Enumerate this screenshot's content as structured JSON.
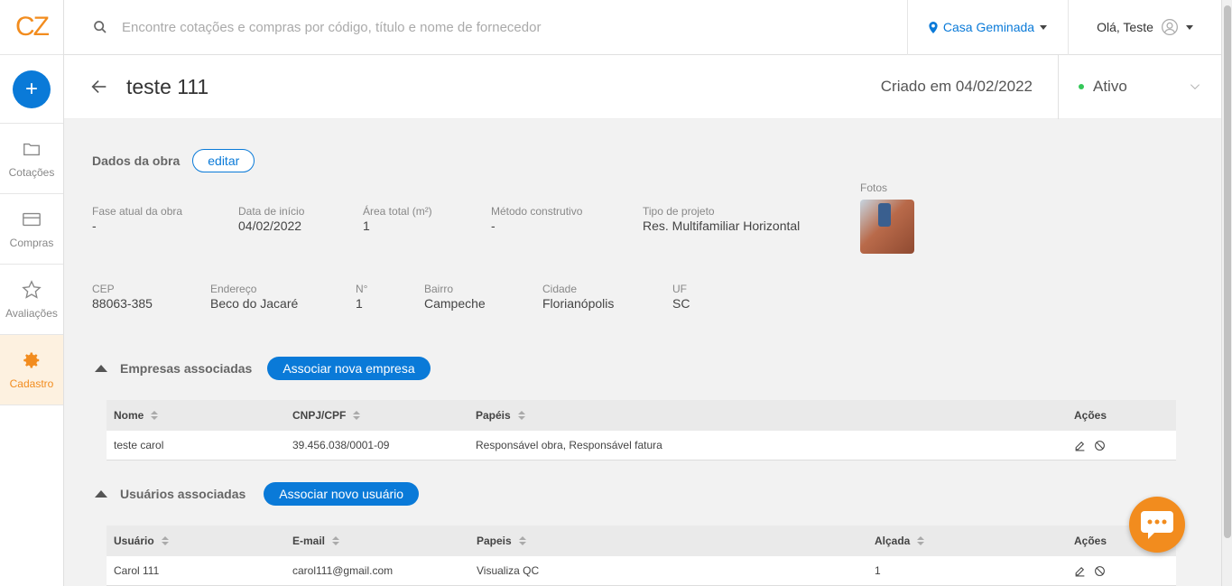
{
  "brand": {
    "logo_text": "CZ",
    "accent": "#f28c1e",
    "primary": "#0a7ad8"
  },
  "sidebar": {
    "new_label": "+",
    "items": [
      {
        "label": "Cotações",
        "icon": "folder-icon"
      },
      {
        "label": "Compras",
        "icon": "card-icon"
      },
      {
        "label": "Avaliações",
        "icon": "star-icon"
      },
      {
        "label": "Cadastro",
        "icon": "gear-icon",
        "active": true
      }
    ]
  },
  "topbar": {
    "search_placeholder": "Encontre cotações e compras por código, título e nome de fornecedor",
    "location": "Casa Geminada",
    "greeting": "Olá, Teste"
  },
  "header": {
    "title": "teste 111",
    "created": "Criado em 04/02/2022",
    "status": "Ativo"
  },
  "obra": {
    "section_title": "Dados da obra",
    "edit_label": "editar",
    "fotos_label": "Fotos",
    "row1": [
      {
        "label": "Fase atual da obra",
        "value": "-"
      },
      {
        "label": "Data de início",
        "value": "04/02/2022"
      },
      {
        "label": "Área total (m²)",
        "value": "1"
      },
      {
        "label": "Método construtivo",
        "value": "-"
      },
      {
        "label": "Tipo de projeto",
        "value": "Res. Multifamiliar Horizontal"
      }
    ],
    "row2": [
      {
        "label": "CEP",
        "value": "88063-385"
      },
      {
        "label": "Endereço",
        "value": "Beco do Jacaré"
      },
      {
        "label": "N°",
        "value": "1"
      },
      {
        "label": "Bairro",
        "value": "Campeche"
      },
      {
        "label": "Cidade",
        "value": "Florianópolis"
      },
      {
        "label": "UF",
        "value": "SC"
      }
    ]
  },
  "empresas": {
    "title": "Empresas associadas",
    "button": "Associar nova empresa",
    "columns": [
      "Nome",
      "CNPJ/CPF",
      "Papéis",
      "Ações"
    ],
    "rows": [
      {
        "nome": "teste carol",
        "cnpj": "39.456.038/0001-09",
        "papeis": "Responsável obra, Responsável fatura"
      }
    ]
  },
  "usuarios": {
    "title": "Usuários associadas",
    "button": "Associar novo usuário",
    "columns": [
      "Usuário",
      "E-mail",
      "Papeis",
      "Alçada",
      "Ações"
    ],
    "rows": [
      {
        "usuario": "Carol 111",
        "email": "carol111@gmail.com",
        "papeis": "Visualiza QC",
        "alcada": "1"
      }
    ]
  }
}
